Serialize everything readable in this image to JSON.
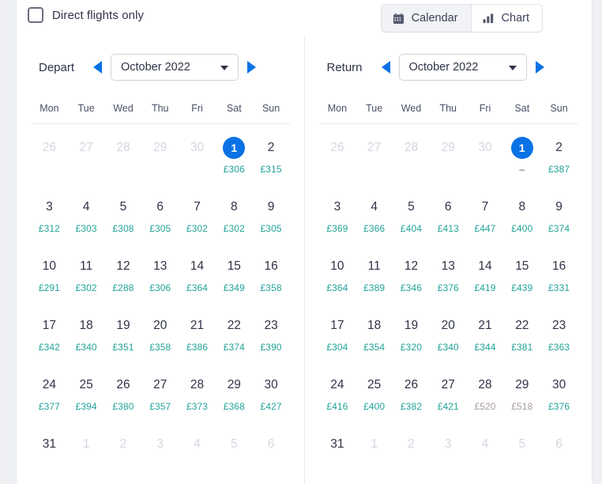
{
  "colors": {
    "accent": "#0a72e5",
    "price_low": "#23a39a",
    "price_high": "#a99aa5",
    "text": "#2f3347",
    "muted": "#d3d7e0",
    "card_bg": "#ffffff",
    "page_bg": "#eef0f4"
  },
  "topbar": {
    "direct_flights_label": "Direct flights only",
    "direct_flights_checked": false,
    "view_toggle": {
      "calendar_label": "Calendar",
      "calendar_icon": "calendar-icon",
      "chart_label": "Chart",
      "chart_icon": "bar-chart-icon",
      "active": "Calendar"
    }
  },
  "weekdays": [
    "Mon",
    "Tue",
    "Wed",
    "Thu",
    "Fri",
    "Sat",
    "Sun"
  ],
  "calendars": [
    {
      "title": "Depart",
      "month": "October 2022",
      "prev_icon": "chevron-left-icon",
      "next_icon": "chevron-right-icon",
      "dropdown_icon": "chevron-down-icon",
      "cells": [
        {
          "day": "26",
          "price": "",
          "state": "muted"
        },
        {
          "day": "27",
          "price": "",
          "state": "muted"
        },
        {
          "day": "28",
          "price": "",
          "state": "muted"
        },
        {
          "day": "29",
          "price": "",
          "state": "muted"
        },
        {
          "day": "30",
          "price": "",
          "state": "muted"
        },
        {
          "day": "1",
          "price": "£306",
          "state": "selected"
        },
        {
          "day": "2",
          "price": "£315",
          "state": "normal"
        },
        {
          "day": "3",
          "price": "£312",
          "state": "normal"
        },
        {
          "day": "4",
          "price": "£303",
          "state": "normal"
        },
        {
          "day": "5",
          "price": "£308",
          "state": "normal"
        },
        {
          "day": "6",
          "price": "£305",
          "state": "normal"
        },
        {
          "day": "7",
          "price": "£302",
          "state": "normal"
        },
        {
          "day": "8",
          "price": "£302",
          "state": "normal"
        },
        {
          "day": "9",
          "price": "£305",
          "state": "normal"
        },
        {
          "day": "10",
          "price": "£291",
          "state": "normal"
        },
        {
          "day": "11",
          "price": "£302",
          "state": "normal"
        },
        {
          "day": "12",
          "price": "£288",
          "state": "normal"
        },
        {
          "day": "13",
          "price": "£306",
          "state": "normal"
        },
        {
          "day": "14",
          "price": "£364",
          "state": "normal"
        },
        {
          "day": "15",
          "price": "£349",
          "state": "normal"
        },
        {
          "day": "16",
          "price": "£358",
          "state": "normal"
        },
        {
          "day": "17",
          "price": "£342",
          "state": "normal"
        },
        {
          "day": "18",
          "price": "£340",
          "state": "normal"
        },
        {
          "day": "19",
          "price": "£351",
          "state": "normal"
        },
        {
          "day": "20",
          "price": "£358",
          "state": "normal"
        },
        {
          "day": "21",
          "price": "£386",
          "state": "normal"
        },
        {
          "day": "22",
          "price": "£374",
          "state": "normal"
        },
        {
          "day": "23",
          "price": "£390",
          "state": "normal"
        },
        {
          "day": "24",
          "price": "£377",
          "state": "normal"
        },
        {
          "day": "25",
          "price": "£394",
          "state": "normal"
        },
        {
          "day": "26",
          "price": "£380",
          "state": "normal"
        },
        {
          "day": "27",
          "price": "£357",
          "state": "normal"
        },
        {
          "day": "28",
          "price": "£373",
          "state": "normal"
        },
        {
          "day": "29",
          "price": "£368",
          "state": "normal"
        },
        {
          "day": "30",
          "price": "£427",
          "state": "normal"
        },
        {
          "day": "31",
          "price": "",
          "state": "normal"
        },
        {
          "day": "1",
          "price": "",
          "state": "muted"
        },
        {
          "day": "2",
          "price": "",
          "state": "muted"
        },
        {
          "day": "3",
          "price": "",
          "state": "muted"
        },
        {
          "day": "4",
          "price": "",
          "state": "muted"
        },
        {
          "day": "5",
          "price": "",
          "state": "muted"
        },
        {
          "day": "6",
          "price": "",
          "state": "muted"
        }
      ]
    },
    {
      "title": "Return",
      "month": "October 2022",
      "prev_icon": "chevron-left-icon",
      "next_icon": "chevron-right-icon",
      "dropdown_icon": "chevron-down-icon",
      "cells": [
        {
          "day": "26",
          "price": "",
          "state": "muted"
        },
        {
          "day": "27",
          "price": "",
          "state": "muted"
        },
        {
          "day": "28",
          "price": "",
          "state": "muted"
        },
        {
          "day": "29",
          "price": "",
          "state": "muted"
        },
        {
          "day": "30",
          "price": "",
          "state": "muted"
        },
        {
          "day": "1",
          "price": "–",
          "state": "selected",
          "price_style": "dash"
        },
        {
          "day": "2",
          "price": "£387",
          "state": "normal"
        },
        {
          "day": "3",
          "price": "£369",
          "state": "normal"
        },
        {
          "day": "4",
          "price": "£366",
          "state": "normal"
        },
        {
          "day": "5",
          "price": "£404",
          "state": "normal"
        },
        {
          "day": "6",
          "price": "£413",
          "state": "normal"
        },
        {
          "day": "7",
          "price": "£447",
          "state": "normal"
        },
        {
          "day": "8",
          "price": "£400",
          "state": "normal"
        },
        {
          "day": "9",
          "price": "£374",
          "state": "normal"
        },
        {
          "day": "10",
          "price": "£364",
          "state": "normal"
        },
        {
          "day": "11",
          "price": "£389",
          "state": "normal"
        },
        {
          "day": "12",
          "price": "£346",
          "state": "normal"
        },
        {
          "day": "13",
          "price": "£376",
          "state": "normal"
        },
        {
          "day": "14",
          "price": "£419",
          "state": "normal"
        },
        {
          "day": "15",
          "price": "£439",
          "state": "normal"
        },
        {
          "day": "16",
          "price": "£331",
          "state": "normal"
        },
        {
          "day": "17",
          "price": "£304",
          "state": "normal"
        },
        {
          "day": "18",
          "price": "£354",
          "state": "normal"
        },
        {
          "day": "19",
          "price": "£320",
          "state": "normal"
        },
        {
          "day": "20",
          "price": "£340",
          "state": "normal"
        },
        {
          "day": "21",
          "price": "£344",
          "state": "normal"
        },
        {
          "day": "22",
          "price": "£381",
          "state": "normal"
        },
        {
          "day": "23",
          "price": "£363",
          "state": "normal"
        },
        {
          "day": "24",
          "price": "£416",
          "state": "normal"
        },
        {
          "day": "25",
          "price": "£400",
          "state": "normal"
        },
        {
          "day": "26",
          "price": "£382",
          "state": "normal"
        },
        {
          "day": "27",
          "price": "£421",
          "state": "normal"
        },
        {
          "day": "28",
          "price": "£520",
          "state": "normal",
          "price_style": "high"
        },
        {
          "day": "29",
          "price": "£518",
          "state": "normal",
          "price_style": "high"
        },
        {
          "day": "30",
          "price": "£376",
          "state": "normal"
        },
        {
          "day": "31",
          "price": "",
          "state": "normal"
        },
        {
          "day": "1",
          "price": "",
          "state": "muted"
        },
        {
          "day": "2",
          "price": "",
          "state": "muted"
        },
        {
          "day": "3",
          "price": "",
          "state": "muted"
        },
        {
          "day": "4",
          "price": "",
          "state": "muted"
        },
        {
          "day": "5",
          "price": "",
          "state": "muted"
        },
        {
          "day": "6",
          "price": "",
          "state": "muted"
        }
      ]
    }
  ]
}
